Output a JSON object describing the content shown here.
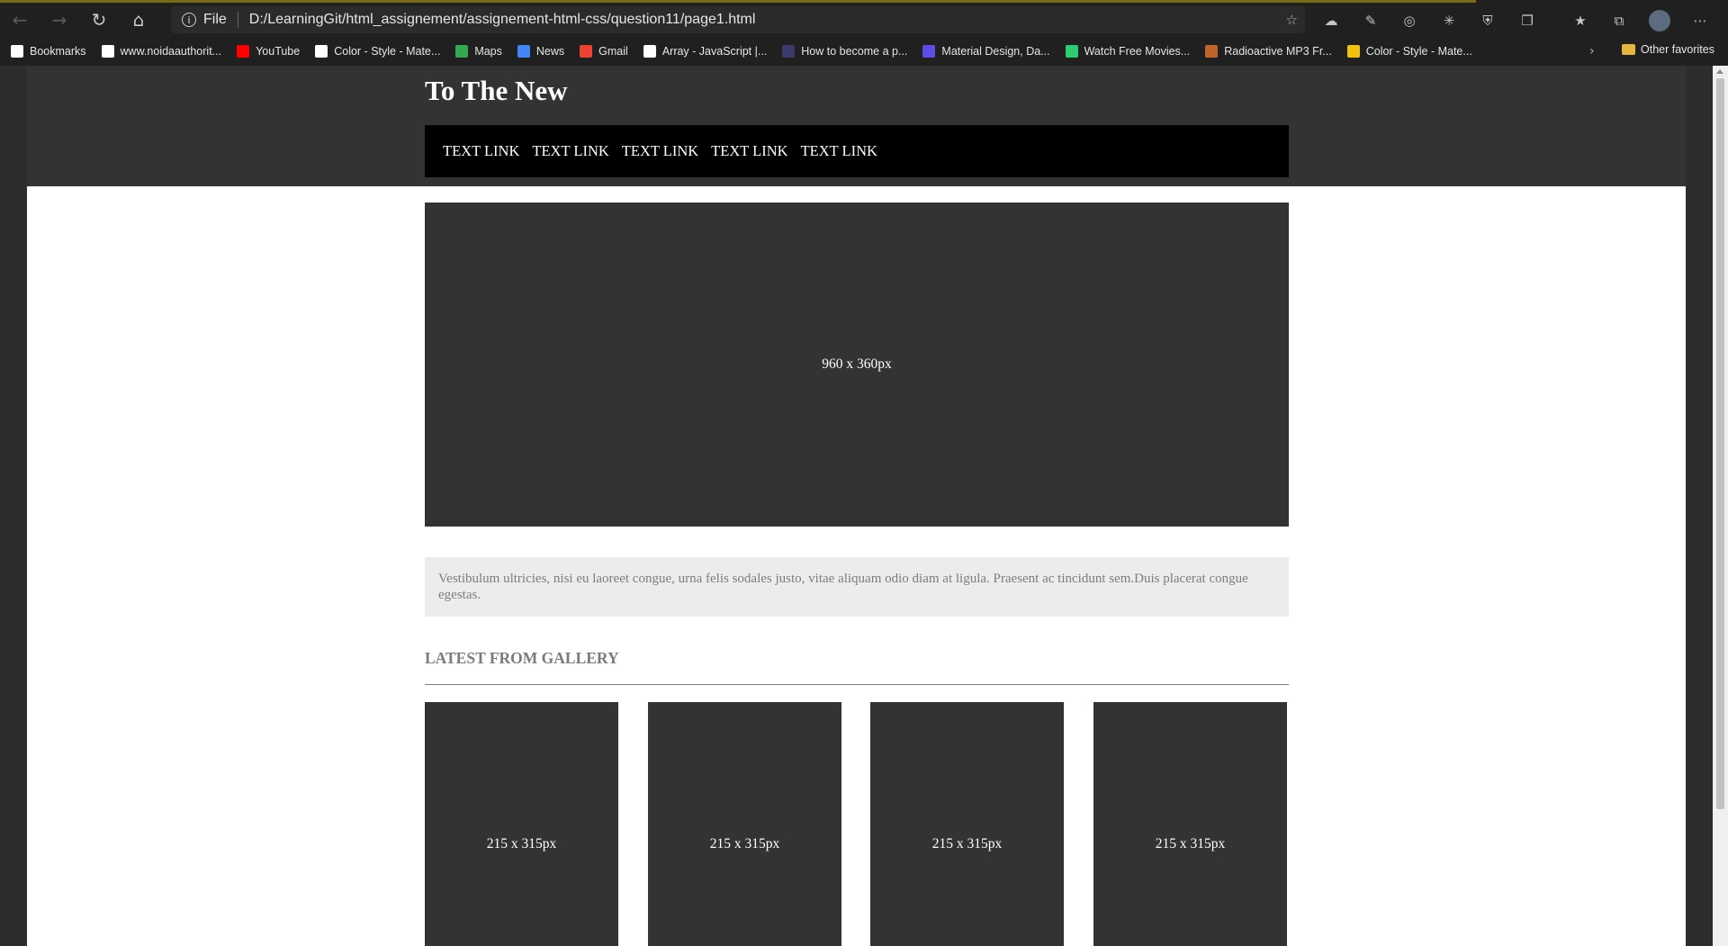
{
  "browser": {
    "address": {
      "scheme": "File",
      "url": "D:/LearningGit/html_assignement/assignement-html-css/question11/page1.html"
    },
    "nav_icons": [
      "back-icon",
      "forward-icon",
      "refresh-icon",
      "home-icon"
    ],
    "extension_icons": [
      "ext-cloud-icon",
      "ext-pen-icon",
      "ext-target-icon",
      "ext-react-icon",
      "ext-shield-icon",
      "ext-puzzle-icon",
      "favorites-icon",
      "collections-icon",
      "profile-avatar",
      "more-icon"
    ],
    "bookmarks": [
      {
        "label": "Bookmarks",
        "icon": "page-icon",
        "color": "#ffffff"
      },
      {
        "label": "www.noidaauthorit...",
        "icon": "page-icon",
        "color": "#ffffff"
      },
      {
        "label": "YouTube",
        "icon": "youtube-icon",
        "color": "#ff0000"
      },
      {
        "label": "Color - Style - Mate...",
        "icon": "material-icon",
        "color": "#ffffff"
      },
      {
        "label": "Maps",
        "icon": "maps-icon",
        "color": "#34a853"
      },
      {
        "label": "News",
        "icon": "news-icon",
        "color": "#4285f4"
      },
      {
        "label": "Gmail",
        "icon": "gmail-icon",
        "color": "#ea4335"
      },
      {
        "label": "Array - JavaScript |...",
        "icon": "mdn-icon",
        "color": "#ffffff"
      },
      {
        "label": "How to become a p...",
        "icon": "angular-icon",
        "color": "#3b3b6b"
      },
      {
        "label": "Material Design, Da...",
        "icon": "up-icon",
        "color": "#5c4ee5"
      },
      {
        "label": "Watch Free Movies...",
        "icon": "play-icon",
        "color": "#2ecc71"
      },
      {
        "label": "Radioactive MP3 Fr...",
        "icon": "paw-icon",
        "color": "#c0652a"
      },
      {
        "label": "Color - Style - Mate...",
        "icon": "material-icon",
        "color": "#f4c20d"
      }
    ],
    "other_favorites": "Other favorites"
  },
  "site": {
    "title": "To The New",
    "nav": [
      "TEXT LINK",
      "TEXT LINK",
      "TEXT LINK",
      "TEXT LINK",
      "TEXT LINK"
    ],
    "hero_label": "960 x 360px",
    "intro_text": "Vestibulum ultricies, nisi eu laoreet congue, urna felis sodales justo, vitae aliquam odio diam at ligula. Praesent ac tincidunt sem.Duis placerat congue egestas.",
    "gallery_heading": "LATEST FROM GALLERY",
    "gallery": [
      "215 x 315px",
      "215 x 315px",
      "215 x 315px",
      "215 x 315px"
    ]
  },
  "colors": {
    "header_bg": "#333333",
    "nav_bg": "#000000",
    "placeholder_bg": "#333333",
    "intro_bg": "#ececec",
    "muted_text": "#7a7a7a"
  }
}
